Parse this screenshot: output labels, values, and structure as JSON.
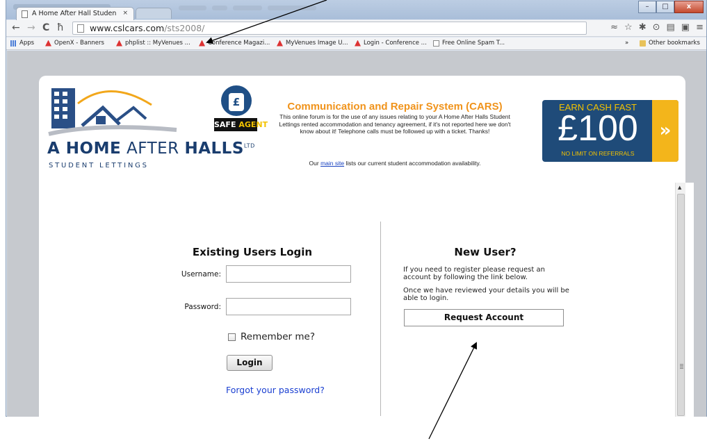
{
  "browser": {
    "tab_title": "A Home After Hall Studen",
    "tab_close": "×",
    "url_domain": "www.cslcars.com",
    "url_path": "/sts2008/",
    "nav": {
      "back": "←",
      "forward": "→",
      "reload": "C",
      "home": "ħ"
    },
    "window_controls": {
      "minimize": "–",
      "maximize": "□",
      "close": "x"
    }
  },
  "bookmarks": [
    {
      "label": "Apps"
    },
    {
      "label": "OpenX - Banners"
    },
    {
      "label": "phplist :: MyVenues ..."
    },
    {
      "label": "Conference Magazi..."
    },
    {
      "label": "MyVenues Image U..."
    },
    {
      "label": "Login - Conference ..."
    },
    {
      "label": "Free Online Spam T..."
    }
  ],
  "bookmarks_more": "»",
  "bookmarks_other": "Other bookmarks",
  "header": {
    "brand_line1_bold": "A HOME",
    "brand_line1_mid": " AFTER ",
    "brand_line1_bold2": "HALLS",
    "brand_ltd": "LTD",
    "brand_line2": "STUDENT LETTINGS",
    "safe_agent_symbol": "£",
    "safe_agent_word1": "SAFE",
    "safe_agent_word2": "AGENT",
    "cars_title": "Communication and Repair System (CARS)",
    "cars_description": "This online forum is for the use of any issues relating to your A Home After Halls Student Lettings rented accommodation and tenancy agreement, if it's not reported here we don't know about it! Telephone calls must be followed up with a ticket. Thanks!",
    "cars_main_prefix": "Our ",
    "cars_main_link": "main site",
    "cars_main_suffix": " lists our current student accommodation availability."
  },
  "banner": {
    "top": "EARN CASH FAST",
    "amount": "£100",
    "bottom": "NO LIMIT ON REFERRALS",
    "arrow": "»"
  },
  "login": {
    "title": "Existing Users Login",
    "username_label": "Username:",
    "username_value": "",
    "password_label": "Password:",
    "password_value": "",
    "remember_label": "Remember me?",
    "login_button": "Login",
    "forgot_link": "Forgot your password?"
  },
  "new_user": {
    "title": "New User?",
    "desc1": "If you need to register please request an account by following the link below.",
    "desc2": "Once we have reviewed your details you will be able to login.",
    "request_button": "Request Account"
  },
  "colors": {
    "brand_navy": "#1a3d6e",
    "cars_orange": "#f0931b",
    "banner_blue": "#1f4b79",
    "banner_yellow": "#f3c200",
    "link_blue": "#1a3fd1"
  }
}
